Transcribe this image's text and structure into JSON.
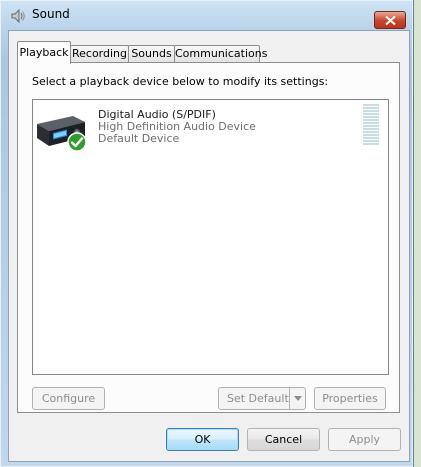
{
  "window": {
    "title": "Sound"
  },
  "tabs": [
    {
      "label": "Playback",
      "active": true
    },
    {
      "label": "Recording",
      "active": false
    },
    {
      "label": "Sounds",
      "active": false
    },
    {
      "label": "Communications",
      "active": false
    }
  ],
  "playback": {
    "instruction": "Select a playback device below to modify its settings:",
    "devices": [
      {
        "name": "Digital Audio (S/PDIF)",
        "description": "High Definition Audio Device",
        "status": "Default Device",
        "icon": "audio-receiver-icon",
        "badge": "green-check-icon"
      }
    ],
    "configure_label": "Configure",
    "set_default_label": "Set Default",
    "properties_label": "Properties"
  },
  "footer": {
    "ok_label": "OK",
    "cancel_label": "Cancel",
    "apply_label": "Apply"
  },
  "colors": {
    "title_bar": "#b9d3ea",
    "close_button": "#c7452b",
    "check_badge": "#2f9e2f",
    "secondary_text": "#6d6d6d"
  }
}
